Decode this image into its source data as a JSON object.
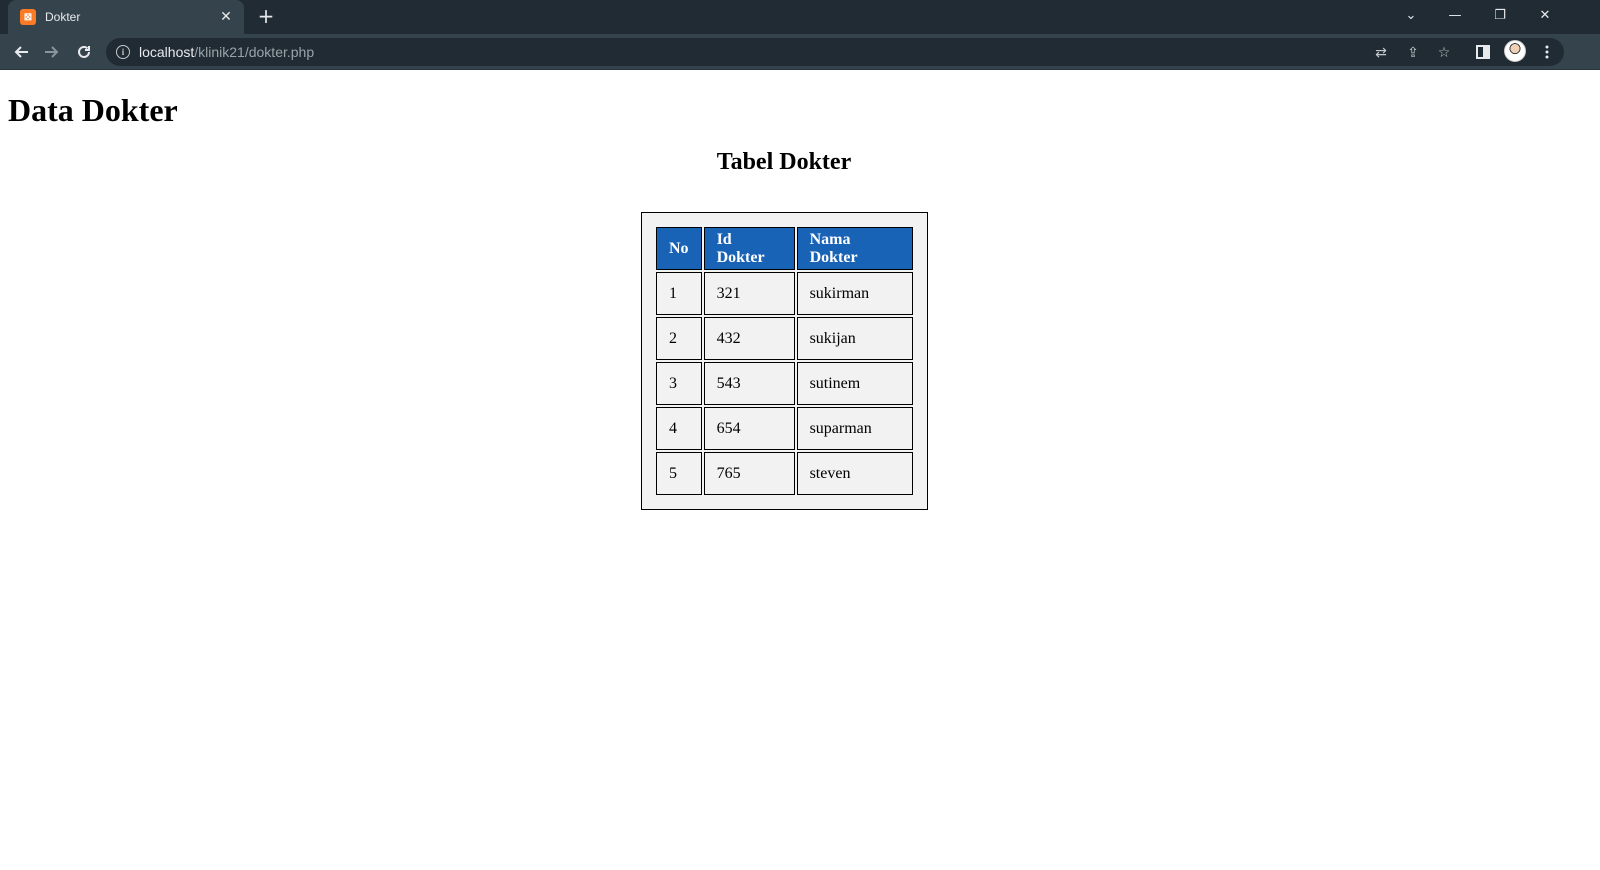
{
  "browser": {
    "tab": {
      "title": "Dokter",
      "favicon": "xampp-icon"
    },
    "url": {
      "host": "localhost",
      "path": "/klinik21/dokter.php"
    }
  },
  "page": {
    "heading": "Data Dokter",
    "table_title": "Tabel Dokter",
    "table": {
      "headers": [
        "No",
        "Id Dokter",
        "Nama Dokter"
      ],
      "rows": [
        [
          "1",
          "321",
          "sukirman"
        ],
        [
          "2",
          "432",
          "sukijan"
        ],
        [
          "3",
          "543",
          "sutinem"
        ],
        [
          "4",
          "654",
          "suparman"
        ],
        [
          "5",
          "765",
          "steven"
        ]
      ]
    }
  },
  "colors": {
    "header_bg": "#1863b6",
    "cell_bg": "#f2f2f2",
    "chrome_bg": "#202b33",
    "toolbar_bg": "#35434c"
  }
}
